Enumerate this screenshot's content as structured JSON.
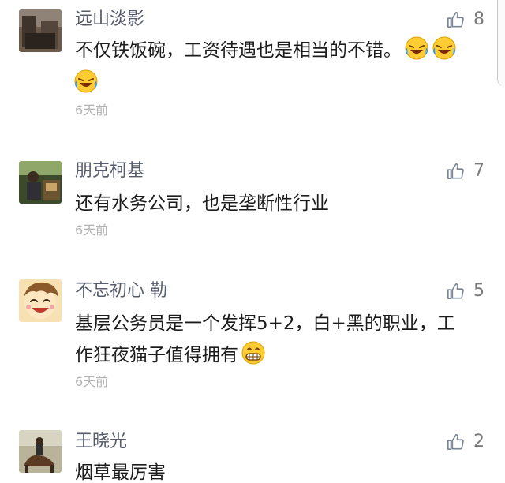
{
  "comments": [
    {
      "username": "远山淡影",
      "likes": "8",
      "lines": [
        "不仅铁饭碗，工资待遇也是相当的不错。"
      ],
      "time": "6天前",
      "emoji_after_text": [
        "laugh-cry-emoji",
        "laugh-cry-emoji"
      ],
      "emoji_line2": [
        "laugh-cry-emoji"
      ]
    },
    {
      "username": "朋克柯基",
      "likes": "7",
      "lines": [
        "还有水务公司，也是垄断性行业"
      ],
      "time": "6天前"
    },
    {
      "username": "不忘初心 勒",
      "likes": "5",
      "lines": [
        "基层公务员是一个发挥5+2，白+黑的职业，工",
        "作狂夜猫子值得拥有"
      ],
      "time": "6天前",
      "emoji_after_text": [
        "grin-emoji"
      ]
    },
    {
      "username": "王晓光",
      "likes": "2",
      "lines": [
        "烟草最厉害"
      ]
    }
  ],
  "colors": {
    "username": "#555b6b",
    "text": "#1c1c1c",
    "time": "#b2b2b2",
    "like_icon": "#7b8496",
    "like_count": "#7a7a7a",
    "background": "#ffffff"
  }
}
